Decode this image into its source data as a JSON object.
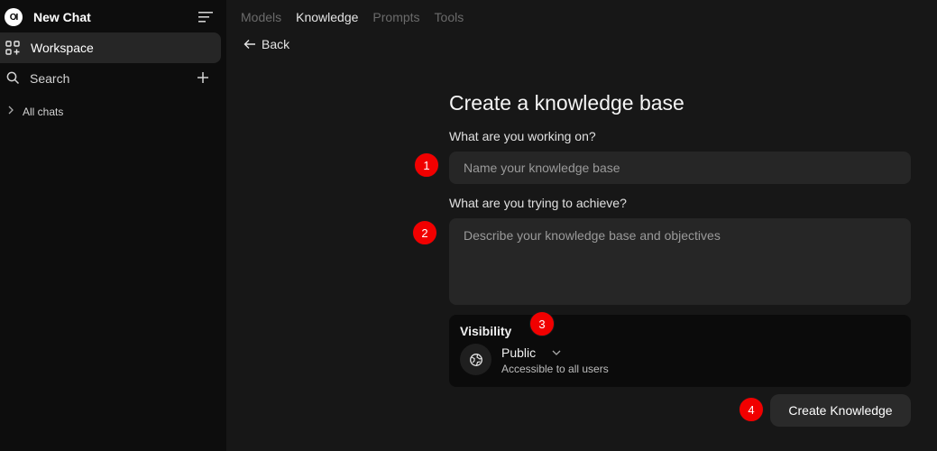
{
  "sidebar": {
    "logo_text": "OI",
    "new_chat": "New Chat",
    "workspace": "Workspace",
    "search": "Search",
    "all_chats": "All chats"
  },
  "tabs": [
    {
      "label": "Models",
      "active": false
    },
    {
      "label": "Knowledge",
      "active": true
    },
    {
      "label": "Prompts",
      "active": false
    },
    {
      "label": "Tools",
      "active": false
    }
  ],
  "back_label": "Back",
  "form": {
    "title": "Create a knowledge base",
    "q1": "What are you working on?",
    "name_placeholder": "Name your knowledge base",
    "q2": "What are you trying to achieve?",
    "desc_placeholder": "Describe your knowledge base and objectives",
    "visibility_title": "Visibility",
    "visibility_value": "Public",
    "visibility_sub": "Accessible to all users",
    "create_label": "Create Knowledge"
  },
  "badges": [
    "1",
    "2",
    "3",
    "4"
  ],
  "colors": {
    "badge": "#f10000",
    "sidebar_bg": "#0d0d0d",
    "main_bg": "#171717",
    "input_bg": "#262626"
  }
}
